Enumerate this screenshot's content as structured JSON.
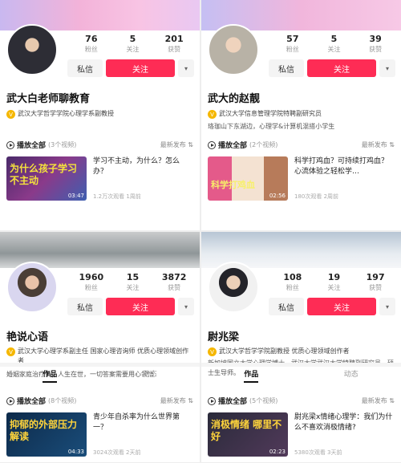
{
  "common": {
    "stat_labels": [
      "粉丝",
      "关注",
      "获赞"
    ],
    "msg_label": "私信",
    "follow_label": "关注",
    "more_glyph": "▾",
    "verified_glyph": "V",
    "play_all": "播放全部",
    "sort_label": "最新发布 ⇅",
    "tabs": [
      "作品",
      "动态"
    ]
  },
  "panels": [
    {
      "name": "武大白老师聊教育",
      "stats": [
        "76",
        "5",
        "201"
      ],
      "cert": "武汉大学哲学学院心理学系副教授",
      "bio": "",
      "video_count": "(3个视频)",
      "video": {
        "thumb_text": "为什么孩子学习不主动",
        "duration": "03:47",
        "title": "学习不主动，为什么？怎么办？",
        "meta": "1.2万次观看  1周前"
      }
    },
    {
      "name": "武大的赵靓",
      "stats": [
        "57",
        "5",
        "39"
      ],
      "cert": "武汉大学信息管理学院特聘副研究员",
      "bio": "珞珈山下东湖边，心理学&计算机混搭小学生",
      "video_count": "(2个视频)",
      "video": {
        "thumb_text": "科学打鸡血",
        "duration": "02:56",
        "title": "科学打鸡血？可持续打鸡血？心流体验之轻松学…",
        "meta": "180次观看  2周前"
      }
    },
    {
      "name": "艳说心语",
      "stats": [
        "1960",
        "15",
        "3872"
      ],
      "cert": "武汉大学心理学系副主任 国家心理咨询师 优质心理领域创作者",
      "bio": "婚姻家庭治疗师；人生在世，一切答案需要用心领悟",
      "video_count": "(8个视频)",
      "video": {
        "thumb_text": "抑郁的外部压力解读",
        "duration": "04:33",
        "title": "青少年自杀率为什么世界第一？",
        "meta": "3024次观看  2天前"
      }
    },
    {
      "name": "尉兆梁",
      "stats": [
        "108",
        "19",
        "197"
      ],
      "cert": "武汉大学哲学学院副教授 优质心理领域创作者",
      "bio": "新加坡国立大学心理学博士，武汉大学武汉大学特聘副研究员，硕士生导师。",
      "video_count": "(5个视频)",
      "video": {
        "thumb_text": "消极情绪 哪里不好",
        "duration": "02:23",
        "title": "尉兆梁x情绪心理学：我们为什么不喜欢消极情绪?",
        "meta": "5380次观看  3天前"
      }
    }
  ]
}
